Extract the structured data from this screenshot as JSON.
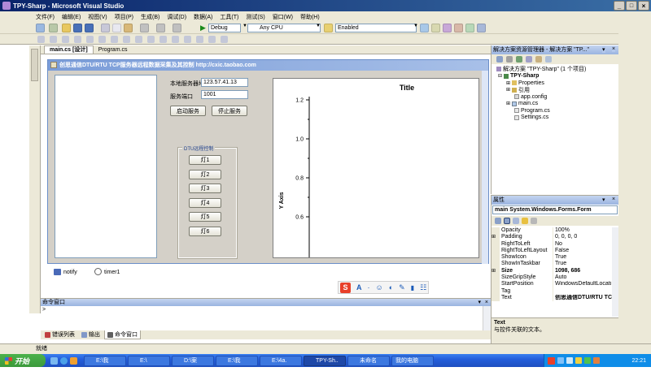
{
  "window": {
    "title": "TPY-Sharp - Microsoft Visual Studio"
  },
  "menu": [
    "文件(F)",
    "编辑(E)",
    "视图(V)",
    "项目(P)",
    "生成(B)",
    "调试(D)",
    "数据(A)",
    "工具(T)",
    "测试(S)",
    "窗口(W)",
    "帮助(H)"
  ],
  "toolbar": {
    "config": "Debug",
    "platform": "Any CPU",
    "enabled": "Enabled"
  },
  "doc_tabs": [
    "main.cs [设计]",
    "Program.cs"
  ],
  "form": {
    "title": "创思通信DTU/RTU TCP服务器远程数据采集及其控制  http://cxic.taobao.com",
    "server_addr_label": "本地服务器地址",
    "server_addr_value": "123.57.41.13",
    "port_label": "服务端口",
    "port_value": "1001",
    "start_btn": "启动服务",
    "stop_btn": "停止服务",
    "group_title": "DTU远程控制",
    "lamps": [
      "灯1",
      "灯2",
      "灯3",
      "灯4",
      "灯5",
      "灯6"
    ]
  },
  "chart_data": {
    "type": "line",
    "title": "Title",
    "ylabel": "Y Axis",
    "yticks": [
      "1.2",
      "1.0",
      "0.8",
      "0.6"
    ],
    "ylim": [
      0.5,
      1.2
    ],
    "series": []
  },
  "components": [
    "notify",
    "timer1"
  ],
  "command_window": {
    "title": "命令窗口",
    "prompt": ">"
  },
  "bottom_tabs": [
    "错误列表",
    "输出",
    "命令窗口"
  ],
  "status": "就绪",
  "solution_explorer": {
    "title": "解决方案资源管理器 - 解决方案 \"TP...\"",
    "items": [
      {
        "label": "解决方案 \"TPY-Sharp\" (1 个项目)",
        "level": 0
      },
      {
        "label": "TPY-Sharp",
        "level": 1
      },
      {
        "label": "Properties",
        "level": 2
      },
      {
        "label": "引用",
        "level": 2
      },
      {
        "label": "app.config",
        "level": 2
      },
      {
        "label": "main.cs",
        "level": 2
      },
      {
        "label": "Program.cs",
        "level": 2
      },
      {
        "label": "Settings.cs",
        "level": 2
      }
    ]
  },
  "properties": {
    "title": "属性",
    "object": "main System.Windows.Forms.Form",
    "rows": [
      {
        "name": "Opacity",
        "value": "100%"
      },
      {
        "name": "Padding",
        "value": "0, 0, 0, 0"
      },
      {
        "name": "RightToLeft",
        "value": "No"
      },
      {
        "name": "RightToLeftLayout",
        "value": "False"
      },
      {
        "name": "ShowIcon",
        "value": "True"
      },
      {
        "name": "ShowInTaskbar",
        "value": "True"
      },
      {
        "name": "Size",
        "value": "1098, 686"
      },
      {
        "name": "SizeGripStyle",
        "value": "Auto"
      },
      {
        "name": "StartPosition",
        "value": "WindowsDefaultLocati"
      },
      {
        "name": "Tag",
        "value": ""
      },
      {
        "name": "Text",
        "value": "创思通信DTU/RTU TC"
      }
    ],
    "desc_title": "Text",
    "desc_text": "与控件关联的文本。"
  },
  "ime": {
    "label": "S"
  },
  "taskbar": {
    "start": "开始",
    "items": [
      "E:\\我",
      "E:\\",
      "D:\\案",
      "E:\\我",
      "E:\\4a.",
      "TPY-Sh..",
      "未命名",
      "我的电脑"
    ],
    "clock": "22:21"
  },
  "colors": {
    "title_blue": "#0a246a",
    "taskbar_blue": "#245edb",
    "start_green": "#3c9a3c"
  }
}
